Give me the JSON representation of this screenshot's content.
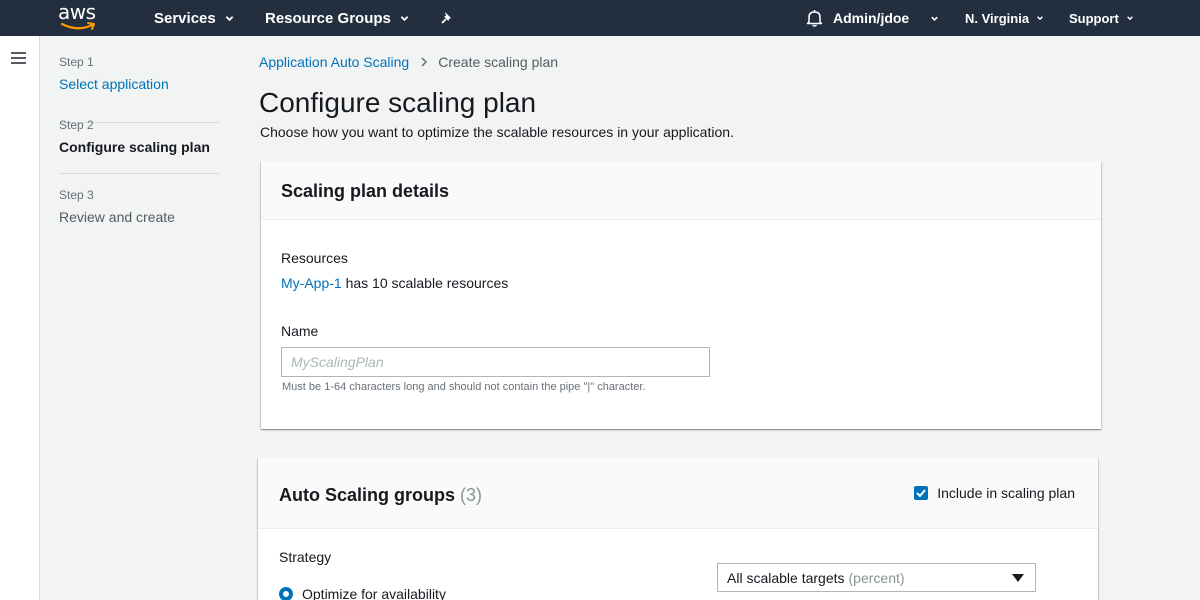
{
  "topnav": {
    "logo_text": "aws",
    "services": "Services",
    "resource_groups": "Resource Groups",
    "user": "Admin/jdoe",
    "region": "N. Virginia",
    "support": "Support",
    "background": "#232f3e"
  },
  "steps": [
    {
      "num": "Step 1",
      "title": "Select application",
      "state": "link"
    },
    {
      "num": "Step 2",
      "title": "Configure scaling plan",
      "state": "current"
    },
    {
      "num": "Step 3",
      "title": "Review and create",
      "state": "pending"
    }
  ],
  "breadcrumb": {
    "parent": "Application Auto Scaling",
    "current": "Create scaling plan"
  },
  "page": {
    "title": "Configure scaling plan",
    "description": "Choose how you want to optimize the scalable resources in your application."
  },
  "details_panel": {
    "title": "Scaling plan details",
    "resources_label": "Resources",
    "app_link": "My-App-1",
    "resources_text": "has 10 scalable resources",
    "name_label": "Name",
    "name_value": "",
    "name_placeholder": "MyScalingPlan",
    "name_hint": "Must be 1-64 characters long and should not contain the pipe \"|\" character."
  },
  "asg_panel": {
    "title": "Auto Scaling groups",
    "count": "(3)",
    "include_label": "Include in scaling plan",
    "include_checked": true,
    "strategy_label": "Strategy",
    "strategy_option": "Optimize for availability",
    "strategy_selected": true,
    "select_value": "All scalable targets",
    "select_sub": "(percent)"
  },
  "colors": {
    "link": "#0073bb",
    "accent": "#0073bb",
    "page_bg": "#f2f3f3"
  }
}
